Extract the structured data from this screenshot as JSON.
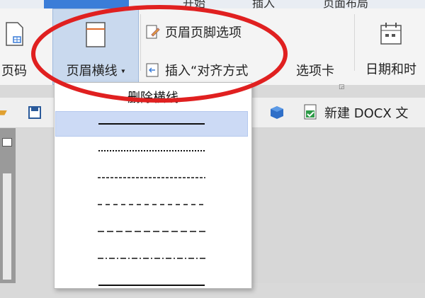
{
  "tabs": [
    {
      "label": "开始"
    },
    {
      "label": "插入"
    },
    {
      "label": "页面布局"
    }
  ],
  "ribbon": {
    "page_number_label": "页码",
    "header_line_label": "页眉横线",
    "header_footer_options_label": "页眉页脚选项",
    "insert_align_tab_label": "插入“对齐方式",
    "tab_stop_label": "选项卡",
    "date_time_label": "日期和时"
  },
  "quick_access": {
    "new_doc_label": "新建 DOCX 文"
  },
  "dropdown": {
    "delete_label": "删除横线",
    "line_styles": [
      {
        "name": "solid",
        "selected": true
      },
      {
        "name": "dotted",
        "selected": false
      },
      {
        "name": "dash-fine",
        "selected": false
      },
      {
        "name": "dashed",
        "selected": false
      },
      {
        "name": "long-dash",
        "selected": false
      },
      {
        "name": "dash-dot",
        "selected": false
      },
      {
        "name": "solid-2",
        "selected": false
      }
    ]
  },
  "colors": {
    "annotation": "#e02020",
    "selected_bg": "#ccdaf5",
    "tab_active": "#3b7dd8"
  }
}
